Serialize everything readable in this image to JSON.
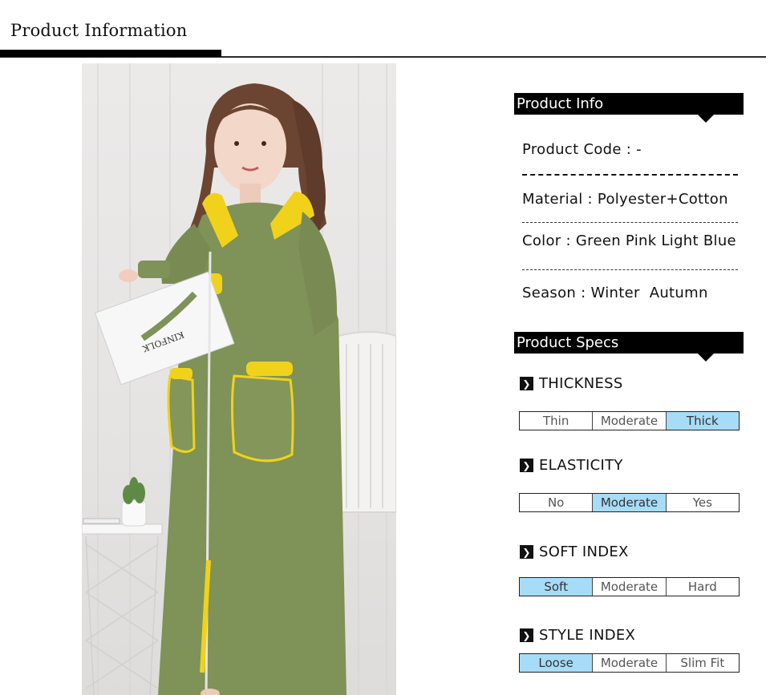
{
  "header": {
    "title": "Product Information"
  },
  "product_info": {
    "heading": "Product Info",
    "lines": [
      "Product Code : -",
      "Material : Polyester+Cotton",
      "Color : Green Pink Light Blue",
      "Season : Winter  Autumn"
    ]
  },
  "product_specs": {
    "heading": "Product Specs",
    "specs": [
      {
        "label": "THICKNESS",
        "options": [
          "Thin",
          "Moderate",
          "Thick"
        ],
        "selected": 2
      },
      {
        "label": "ELASTICITY",
        "options": [
          "No",
          "Moderate",
          "Yes"
        ],
        "selected": 1
      },
      {
        "label": "SOFT INDEX",
        "options": [
          "Soft",
          "Moderate",
          "Hard"
        ],
        "selected": 0
      },
      {
        "label": "STYLE INDEX",
        "options": [
          "Loose",
          "Moderate",
          "Slim Fit"
        ],
        "selected": 0
      }
    ]
  },
  "photo": {
    "magazine_text": "KINFOLK",
    "colors": {
      "robe": "#7f9257",
      "lining": "#f1d21b",
      "background": "#e8e6e5"
    }
  },
  "colors": {
    "selected_option": "#a7dcf8",
    "heading_bg": "#000000"
  },
  "icons": {
    "spec_marker": "chevron-right-icon",
    "section_notch": "caret-down-icon"
  }
}
